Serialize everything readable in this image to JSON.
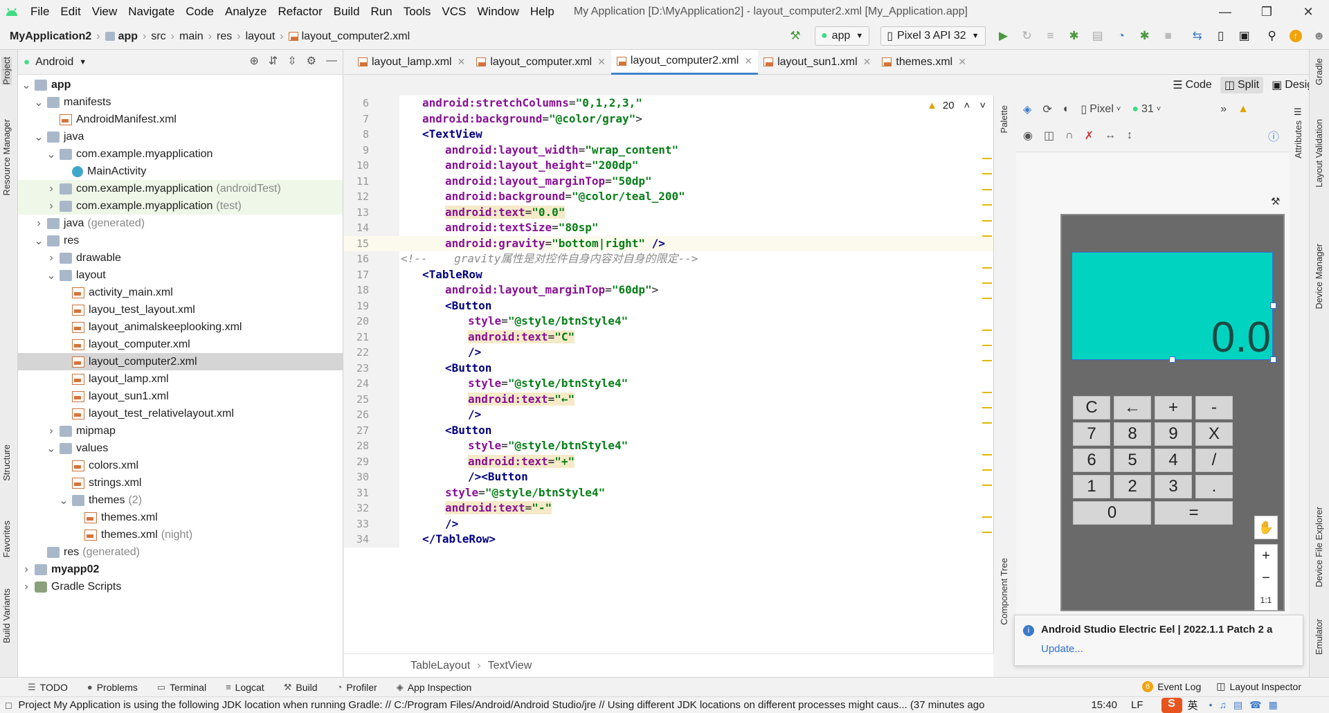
{
  "menu": [
    "File",
    "Edit",
    "View",
    "Navigate",
    "Code",
    "Analyze",
    "Refactor",
    "Build",
    "Run",
    "Tools",
    "VCS",
    "Window",
    "Help"
  ],
  "window_title": "My Application [D:\\MyApplication2] - layout_computer2.xml [My_Application.app]",
  "breadcrumb": [
    "MyApplication2",
    "app",
    "src",
    "main",
    "res",
    "layout",
    "layout_computer2.xml"
  ],
  "toolbar": {
    "module": "app",
    "device": "Pixel 3 API 32"
  },
  "left_strip": {
    "project": "Project",
    "resource_manager": "Resource Manager",
    "structure": "Structure",
    "favorites": "Favorites",
    "build_variants": "Build Variants"
  },
  "project_panel": {
    "view_selector": "Android"
  },
  "tree": [
    {
      "d": 0,
      "chev": "v",
      "icon": "folder",
      "label": "app",
      "bold": true,
      "note": ""
    },
    {
      "d": 1,
      "chev": "v",
      "icon": "folder",
      "label": "manifests",
      "note": ""
    },
    {
      "d": 2,
      "chev": "",
      "icon": "xml",
      "label": "AndroidManifest.xml",
      "note": ""
    },
    {
      "d": 1,
      "chev": "v",
      "icon": "folder",
      "label": "java",
      "note": ""
    },
    {
      "d": 2,
      "chev": "v",
      "icon": "folder",
      "label": "com.example.myapplication",
      "note": ""
    },
    {
      "d": 3,
      "chev": "",
      "icon": "class",
      "label": "MainActivity",
      "note": ""
    },
    {
      "d": 2,
      "chev": ">",
      "icon": "folder",
      "label": "com.example.myapplication",
      "note": "(androidTest)",
      "tint": true
    },
    {
      "d": 2,
      "chev": ">",
      "icon": "folder",
      "label": "com.example.myapplication",
      "note": "(test)",
      "tint": true
    },
    {
      "d": 1,
      "chev": ">",
      "icon": "folder",
      "label": "java",
      "note": "(generated)"
    },
    {
      "d": 1,
      "chev": "v",
      "icon": "folder",
      "label": "res",
      "note": ""
    },
    {
      "d": 2,
      "chev": ">",
      "icon": "folder",
      "label": "drawable",
      "note": ""
    },
    {
      "d": 2,
      "chev": "v",
      "icon": "folder",
      "label": "layout",
      "note": ""
    },
    {
      "d": 3,
      "chev": "",
      "icon": "xml",
      "label": "activity_main.xml",
      "note": ""
    },
    {
      "d": 3,
      "chev": "",
      "icon": "xml",
      "label": "layou_test_layout.xml",
      "note": ""
    },
    {
      "d": 3,
      "chev": "",
      "icon": "xml",
      "label": "layout_animalskeeplooking.xml",
      "note": ""
    },
    {
      "d": 3,
      "chev": "",
      "icon": "xml",
      "label": "layout_computer.xml",
      "note": ""
    },
    {
      "d": 3,
      "chev": "",
      "icon": "xml",
      "label": "layout_computer2.xml",
      "note": "",
      "selected": true
    },
    {
      "d": 3,
      "chev": "",
      "icon": "xml",
      "label": "layout_lamp.xml",
      "note": ""
    },
    {
      "d": 3,
      "chev": "",
      "icon": "xml",
      "label": "layout_sun1.xml",
      "note": ""
    },
    {
      "d": 3,
      "chev": "",
      "icon": "xml",
      "label": "layout_test_relativelayout.xml",
      "note": ""
    },
    {
      "d": 2,
      "chev": ">",
      "icon": "folder",
      "label": "mipmap",
      "note": ""
    },
    {
      "d": 2,
      "chev": "v",
      "icon": "folder",
      "label": "values",
      "note": ""
    },
    {
      "d": 3,
      "chev": "",
      "icon": "xml",
      "label": "colors.xml",
      "note": ""
    },
    {
      "d": 3,
      "chev": "",
      "icon": "xml",
      "label": "strings.xml",
      "note": ""
    },
    {
      "d": 3,
      "chev": "v",
      "icon": "folder",
      "label": "themes",
      "note": "(2)"
    },
    {
      "d": 4,
      "chev": "",
      "icon": "xml",
      "label": "themes.xml",
      "note": ""
    },
    {
      "d": 4,
      "chev": "",
      "icon": "xml",
      "label": "themes.xml",
      "note": "(night)"
    },
    {
      "d": 1,
      "chev": "",
      "icon": "folder",
      "label": "res",
      "note": "(generated)"
    },
    {
      "d": 0,
      "chev": ">",
      "icon": "folder",
      "label": "myapp02",
      "bold": true,
      "note": ""
    },
    {
      "d": 0,
      "chev": ">",
      "icon": "gradle",
      "label": "Gradle Scripts",
      "note": ""
    }
  ],
  "tabs": [
    {
      "label": "layout_lamp.xml",
      "active": false
    },
    {
      "label": "layout_computer.xml",
      "active": false
    },
    {
      "label": "layout_computer2.xml",
      "active": true
    },
    {
      "label": "layout_sun1.xml",
      "active": false
    },
    {
      "label": "themes.xml",
      "active": false
    }
  ],
  "view_modes": {
    "code": "Code",
    "split": "Split",
    "design": "Design"
  },
  "warnings_count": "20",
  "code": [
    {
      "n": "6",
      "ind": 1,
      "parts": [
        [
          "attr",
          "android:stretchColumns"
        ],
        [
          "txt",
          "="
        ],
        [
          "val",
          "\"0,1,2,3,\""
        ]
      ]
    },
    {
      "n": "7",
      "ind": 1,
      "parts": [
        [
          "attr",
          "android:background"
        ],
        [
          "txt",
          "="
        ],
        [
          "val",
          "\"@color/gray\""
        ],
        [
          "txt",
          ">"
        ]
      ]
    },
    {
      "n": "8",
      "ind": 1,
      "parts": [
        [
          "kw",
          "<TextView"
        ]
      ]
    },
    {
      "n": "9",
      "ind": 2,
      "parts": [
        [
          "attr",
          "android:layout_width"
        ],
        [
          "txt",
          "="
        ],
        [
          "val",
          "\"wrap_content\""
        ]
      ]
    },
    {
      "n": "10",
      "ind": 2,
      "parts": [
        [
          "attr",
          "android:layout_height"
        ],
        [
          "txt",
          "="
        ],
        [
          "val",
          "\"200dp\""
        ]
      ]
    },
    {
      "n": "11",
      "ind": 2,
      "parts": [
        [
          "attr",
          "android:layout_marginTop"
        ],
        [
          "txt",
          "="
        ],
        [
          "val",
          "\"50dp\""
        ]
      ]
    },
    {
      "n": "12",
      "ind": 2,
      "parts": [
        [
          "attr",
          "android:background"
        ],
        [
          "txt",
          "="
        ],
        [
          "val",
          "\"@color/teal_200\""
        ]
      ]
    },
    {
      "n": "13",
      "ind": 2,
      "hl": true,
      "parts": [
        [
          "attr",
          "android:text"
        ],
        [
          "txt",
          "="
        ],
        [
          "val",
          "\"0.0\""
        ]
      ]
    },
    {
      "n": "14",
      "ind": 2,
      "parts": [
        [
          "attr",
          "android:textSize"
        ],
        [
          "txt",
          "="
        ],
        [
          "val",
          "\"80sp\""
        ]
      ]
    },
    {
      "n": "15",
      "ind": 2,
      "cur": true,
      "parts": [
        [
          "attr",
          "android:gravity"
        ],
        [
          "txt",
          "="
        ],
        [
          "val",
          "\"bottom|right\""
        ],
        [
          "txt",
          " "
        ],
        [
          "kw",
          "/>"
        ]
      ]
    },
    {
      "n": "16",
      "ind": 0,
      "parts": [
        [
          "cm",
          "<!--    gravity属性是对控件自身内容对自身的限定-->"
        ]
      ]
    },
    {
      "n": "17",
      "ind": 1,
      "parts": [
        [
          "kw",
          "<TableRow"
        ]
      ]
    },
    {
      "n": "18",
      "ind": 2,
      "parts": [
        [
          "attr",
          "android:layout_marginTop"
        ],
        [
          "txt",
          "="
        ],
        [
          "val",
          "\"60dp\""
        ],
        [
          "txt",
          ">"
        ]
      ]
    },
    {
      "n": "19",
      "ind": 2,
      "parts": [
        [
          "kw",
          "<Button"
        ]
      ]
    },
    {
      "n": "20",
      "ind": 3,
      "parts": [
        [
          "attr",
          "style"
        ],
        [
          "txt",
          "="
        ],
        [
          "val",
          "\"@style/btnStyle4\""
        ]
      ]
    },
    {
      "n": "21",
      "ind": 3,
      "hl": true,
      "parts": [
        [
          "attr",
          "android:text"
        ],
        [
          "txt",
          "="
        ],
        [
          "val",
          "\"C\""
        ]
      ]
    },
    {
      "n": "22",
      "ind": 3,
      "parts": [
        [
          "kw",
          "/>"
        ]
      ]
    },
    {
      "n": "23",
      "ind": 2,
      "parts": [
        [
          "kw",
          "<Button"
        ]
      ]
    },
    {
      "n": "24",
      "ind": 3,
      "parts": [
        [
          "attr",
          "style"
        ],
        [
          "txt",
          "="
        ],
        [
          "val",
          "\"@style/btnStyle4\""
        ]
      ]
    },
    {
      "n": "25",
      "ind": 3,
      "hl": true,
      "parts": [
        [
          "attr",
          "android:text"
        ],
        [
          "txt",
          "="
        ],
        [
          "val",
          "\"←\""
        ]
      ]
    },
    {
      "n": "26",
      "ind": 3,
      "parts": [
        [
          "kw",
          "/>"
        ]
      ]
    },
    {
      "n": "27",
      "ind": 2,
      "parts": [
        [
          "kw",
          "<Button"
        ]
      ]
    },
    {
      "n": "28",
      "ind": 3,
      "parts": [
        [
          "attr",
          "style"
        ],
        [
          "txt",
          "="
        ],
        [
          "val",
          "\"@style/btnStyle4\""
        ]
      ]
    },
    {
      "n": "29",
      "ind": 3,
      "hl": true,
      "parts": [
        [
          "attr",
          "android:text"
        ],
        [
          "txt",
          "="
        ],
        [
          "val",
          "\"+\""
        ]
      ]
    },
    {
      "n": "30",
      "ind": 3,
      "parts": [
        [
          "kw",
          "/><Button"
        ]
      ]
    },
    {
      "n": "31",
      "ind": 2,
      "parts": [
        [
          "attr",
          "style"
        ],
        [
          "txt",
          "="
        ],
        [
          "val",
          "\"@style/btnStyle4\""
        ]
      ]
    },
    {
      "n": "32",
      "ind": 2,
      "hl": true,
      "parts": [
        [
          "attr",
          "android:text"
        ],
        [
          "txt",
          "="
        ],
        [
          "val",
          "\"-\""
        ]
      ]
    },
    {
      "n": "33",
      "ind": 2,
      "parts": [
        [
          "kw",
          "/>"
        ]
      ]
    },
    {
      "n": "34",
      "ind": 1,
      "parts": [
        [
          "kw",
          "</TableRow>"
        ]
      ]
    }
  ],
  "editor_breadcrumb": [
    "TableLayout",
    "TextView"
  ],
  "preview": {
    "device": "Pixel",
    "api": "31",
    "display_text": "0.0",
    "keys": [
      [
        "C",
        "←",
        "+",
        "-"
      ],
      [
        "7",
        "8",
        "9",
        "X"
      ],
      [
        "6",
        "5",
        "4",
        "/"
      ],
      [
        "1",
        "2",
        "3",
        "."
      ],
      [
        "0",
        "="
      ]
    ],
    "zoom": [
      "+",
      "−",
      "1:1"
    ]
  },
  "right_tabs": {
    "palette": "Palette",
    "component_tree": "Component Tree",
    "attributes": "Attributes",
    "gradle": "Gradle",
    "layout_validation": "Layout Validation",
    "device_manager": "Device Manager",
    "device_file_explorer": "Device File Explorer",
    "emulator": "Emulator"
  },
  "notification": {
    "title": "Android Studio Electric Eel | 2022.1.1 Patch 2 a",
    "link": "Update..."
  },
  "bottom_tools": [
    "TODO",
    "Problems",
    "Terminal",
    "Logcat",
    "Build",
    "Profiler",
    "App Inspection"
  ],
  "bottom_right": {
    "event_log": "Event Log",
    "event_count": "6",
    "layout_inspector": "Layout Inspector"
  },
  "status": {
    "message": "Project My Application is using the following JDK location when running Gradle: // C:/Program Files/Android/Android Studio/jre // Using different JDK locations on different processes might caus... (37 minutes ago",
    "time": "15:40",
    "line_sep": "LF",
    "ime": "英"
  },
  "colors": {
    "accent": "#4083c9",
    "teal": "#00d4c0",
    "device_bg": "#6a6a6a"
  }
}
